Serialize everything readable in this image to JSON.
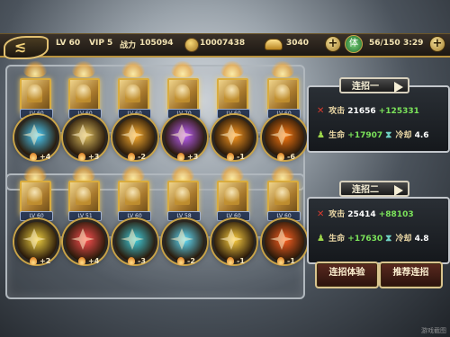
{
  "topbar": {
    "level": "LV 60",
    "vip": "VIP 5",
    "power_label": "战力",
    "power_value": "105094",
    "coins": "10007438",
    "ingots": "3040",
    "stamina_icon": "体",
    "stamina": "56/150",
    "timer": "3:29"
  },
  "row1": [
    {
      "level": "LV 60",
      "value": "+4",
      "orb_color": "#4ad0ff",
      "icon": "crystal-icon"
    },
    {
      "level": "LV 60",
      "value": "+3",
      "orb_color": "#e0c060",
      "icon": "lightning-icon"
    },
    {
      "level": "LV 60",
      "value": "-2",
      "orb_color": "#ffb030",
      "icon": "web-icon"
    },
    {
      "level": "LV 70",
      "value": "+3",
      "orb_color": "#c060ff",
      "icon": "cage-icon"
    },
    {
      "level": "LV 60",
      "value": "-1",
      "orb_color": "#ff9a20",
      "icon": "slash-icon"
    },
    {
      "level": "LV 60",
      "value": "-6",
      "orb_color": "#ff7a10",
      "icon": "burst-icon"
    }
  ],
  "row2": [
    {
      "level": "LV 60",
      "value": "+2",
      "orb_color": "#f0d040",
      "icon": "chevron-icon"
    },
    {
      "level": "LV 51",
      "value": "+4",
      "orb_color": "#ff5050",
      "icon": "star-burst-icon"
    },
    {
      "level": "LV 60",
      "value": "-3",
      "orb_color": "#40d0e0",
      "icon": "claw-icon"
    },
    {
      "level": "LV 58",
      "value": "-2",
      "orb_color": "#60e0ff",
      "icon": "arrow-icon"
    },
    {
      "level": "LV 60",
      "value": "-1",
      "orb_color": "#ffd040",
      "icon": "pillar-icon"
    },
    {
      "level": "LV 60",
      "value": "-1",
      "orb_color": "#ff6020",
      "icon": "vortex-icon"
    }
  ],
  "combo1": {
    "title": "连招一",
    "attack_label": "攻击",
    "attack": "21656",
    "attack_bonus": "+125331",
    "hp_label": "生命",
    "hp_bonus": "+17907",
    "cooldown_label": "冷却",
    "cooldown": "4.6"
  },
  "combo2": {
    "title": "连招二",
    "attack_label": "攻击",
    "attack": "25414",
    "attack_bonus": "+88103",
    "hp_label": "生命",
    "hp_bonus": "+17630",
    "cooldown_label": "冷却",
    "cooldown": "4.8"
  },
  "buttons": {
    "trial": "连招体验",
    "recommend": "推荐连招"
  },
  "watermark": "游戏截图"
}
